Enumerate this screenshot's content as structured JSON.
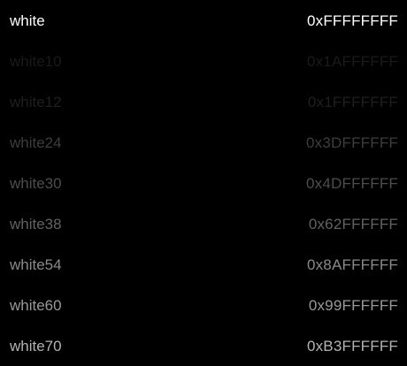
{
  "colors": [
    {
      "name": "white",
      "hex": "0xFFFFFFFF",
      "text_color": "#FFFFFF"
    },
    {
      "name": "white10",
      "hex": "0x1AFFFFFF",
      "text_color": "#1A1A1A"
    },
    {
      "name": "white12",
      "hex": "0x1FFFFFFF",
      "text_color": "#1F1F1F"
    },
    {
      "name": "white24",
      "hex": "0x3DFFFFFF",
      "text_color": "#3D3D3D"
    },
    {
      "name": "white30",
      "hex": "0x4DFFFFFF",
      "text_color": "#4D4D4D"
    },
    {
      "name": "white38",
      "hex": "0x62FFFFFF",
      "text_color": "#626262"
    },
    {
      "name": "white54",
      "hex": "0x8AFFFFFF",
      "text_color": "#8A8A8A"
    },
    {
      "name": "white60",
      "hex": "0x99FFFFFF",
      "text_color": "#999999"
    },
    {
      "name": "white70",
      "hex": "0xB3FFFFFF",
      "text_color": "#B3B3B3"
    }
  ]
}
